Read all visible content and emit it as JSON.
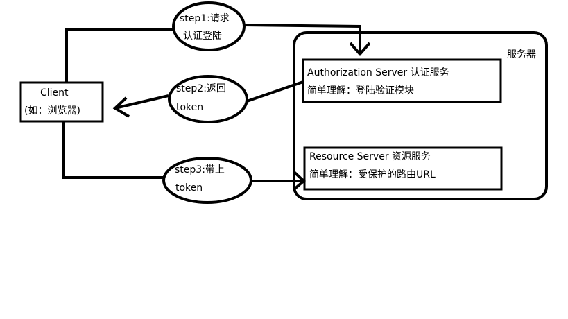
{
  "client": {
    "line1": "Client",
    "line2": "(如：浏览器)"
  },
  "server_group": {
    "label": "服务器"
  },
  "auth_server": {
    "title": "Authorization Server 认证服务",
    "desc": "简单理解：登陆验证模块"
  },
  "resource_server": {
    "title": "Resource Server 资源服务",
    "desc": "简单理解：受保护的路由URL"
  },
  "steps": [
    {
      "line1": "step1:请求",
      "line2": "认证登陆"
    },
    {
      "line1": "step2:返回",
      "line2": "token"
    },
    {
      "line1": "step3:带上",
      "line2": "token"
    }
  ]
}
